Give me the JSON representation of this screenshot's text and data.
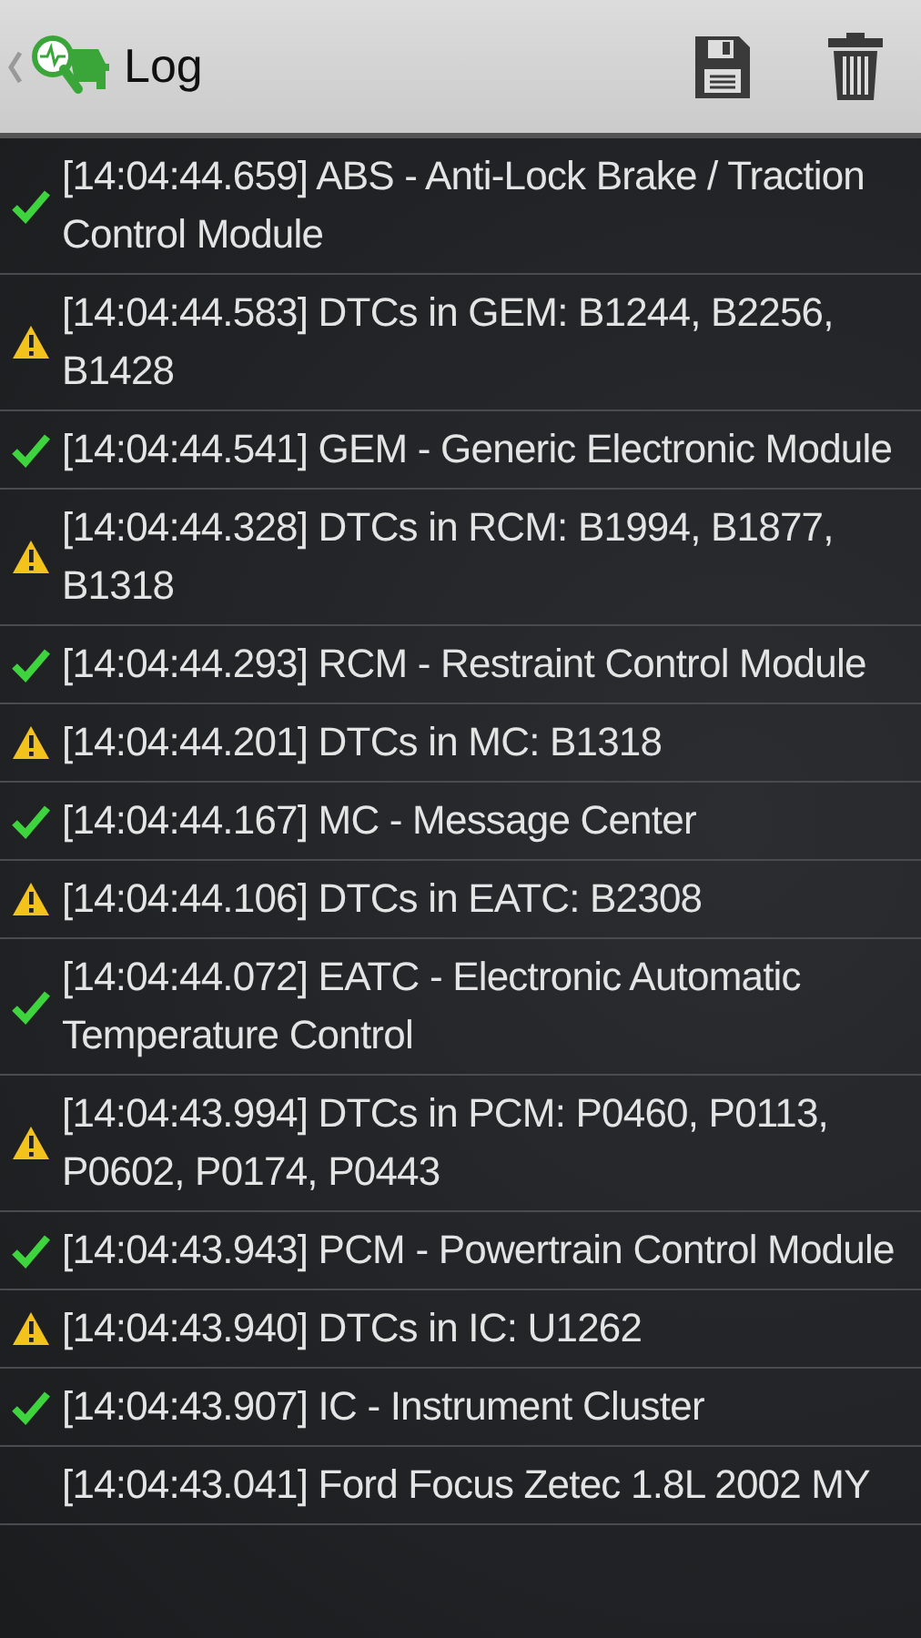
{
  "toolbar": {
    "title": "Log"
  },
  "entries": [
    {
      "kind": "ok",
      "text": "[14:04:44.659] ABS - Anti-Lock Brake / Traction Control Module"
    },
    {
      "kind": "warning",
      "text": "[14:04:44.583] DTCs in GEM: B1244, B2256, B1428"
    },
    {
      "kind": "ok",
      "text": "[14:04:44.541] GEM - Generic Electronic Module"
    },
    {
      "kind": "warning",
      "text": "[14:04:44.328] DTCs in RCM: B1994, B1877, B1318"
    },
    {
      "kind": "ok",
      "text": "[14:04:44.293] RCM - Restraint Control Module"
    },
    {
      "kind": "warning",
      "text": "[14:04:44.201] DTCs in MC: B1318"
    },
    {
      "kind": "ok",
      "text": "[14:04:44.167] MC - Message Center"
    },
    {
      "kind": "warning",
      "text": "[14:04:44.106] DTCs in EATC: B2308"
    },
    {
      "kind": "ok",
      "text": "[14:04:44.072] EATC - Electronic Automatic Temperature Control"
    },
    {
      "kind": "warning",
      "text": "[14:04:43.994] DTCs in PCM: P0460, P0113, P0602, P0174, P0443"
    },
    {
      "kind": "ok",
      "text": "[14:04:43.943] PCM - Powertrain Control Module"
    },
    {
      "kind": "warning",
      "text": "[14:04:43.940] DTCs in IC: U1262"
    },
    {
      "kind": "ok",
      "text": "[14:04:43.907] IC - Instrument Cluster"
    },
    {
      "text": "[14:04:43.041] Ford Focus Zetec 1.8L 2002 MY"
    }
  ]
}
